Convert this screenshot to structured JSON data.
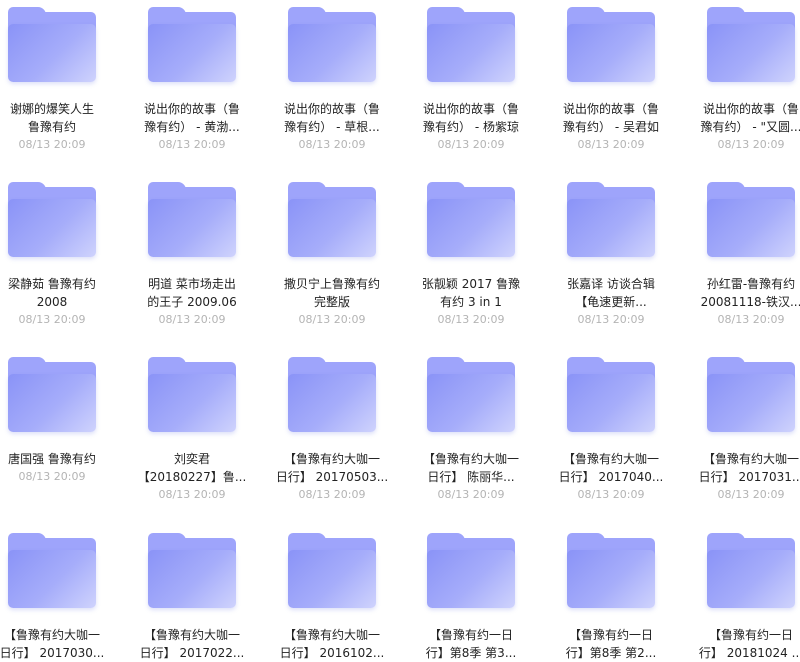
{
  "folders": [
    {
      "line1": "谢娜的爆笑人生",
      "line2": "鲁豫有约",
      "date": "08/13 20:09"
    },
    {
      "line1": "说出你的故事（鲁",
      "line2": "豫有约） - 黄渤...",
      "date": "08/13 20:09"
    },
    {
      "line1": "说出你的故事（鲁",
      "line2": "豫有约） - 草根...",
      "date": "08/13 20:09"
    },
    {
      "line1": "说出你的故事（鲁",
      "line2": "豫有约） - 杨紫琼",
      "date": "08/13 20:09"
    },
    {
      "line1": "说出你的故事（鲁",
      "line2": "豫有约） - 吴君如",
      "date": "08/13 20:09"
    },
    {
      "line1": "说出你的故事（鲁",
      "line2": "豫有约） - \"又圆...",
      "date": "08/13 20:09"
    },
    {
      "line1": "梁静茹 鲁豫有约",
      "line2": "2008",
      "date": "08/13 20:09"
    },
    {
      "line1": "明道 菜市场走出",
      "line2": "的王子 2009.06",
      "date": "08/13 20:09"
    },
    {
      "line1": "撒贝宁上鲁豫有约",
      "line2": "完整版",
      "date": "08/13 20:09"
    },
    {
      "line1": "张靓颖 2017 鲁豫",
      "line2": "有约 3 in 1",
      "date": "08/13 20:09"
    },
    {
      "line1": "张嘉译 访谈合辑",
      "line2": "【龟速更新...",
      "date": "08/13 20:09"
    },
    {
      "line1": "孙红雷-鲁豫有约",
      "line2": "20081118-铁汉...",
      "date": "08/13 20:09"
    },
    {
      "line1": "唐国强 鲁豫有约",
      "line2": "",
      "date": "08/13 20:09"
    },
    {
      "line1": "刘奕君",
      "line2": "【20180227】鲁...",
      "date": "08/13 20:09"
    },
    {
      "line1": "【鲁豫有约大咖一",
      "line2": "日行】 20170503...",
      "date": "08/13 20:09"
    },
    {
      "line1": "【鲁豫有约大咖一",
      "line2": "日行】 陈丽华...",
      "date": "08/13 20:09"
    },
    {
      "line1": "【鲁豫有约大咖一",
      "line2": "日行】 2017040...",
      "date": "08/13 20:09"
    },
    {
      "line1": "【鲁豫有约大咖一",
      "line2": "日行】 2017031...",
      "date": "08/13 20:09"
    },
    {
      "line1": "【鲁豫有约大咖一",
      "line2": "日行】 2017030...",
      "date": ""
    },
    {
      "line1": "【鲁豫有约大咖一",
      "line2": "日行】 2017022...",
      "date": ""
    },
    {
      "line1": "【鲁豫有约大咖一",
      "line2": "日行】 2016102...",
      "date": ""
    },
    {
      "line1": "【鲁豫有约一日",
      "line2": "行】第8季 第3...",
      "date": ""
    },
    {
      "line1": "【鲁豫有约一日",
      "line2": "行】第8季 第2...",
      "date": ""
    },
    {
      "line1": "【鲁豫有约一日",
      "line2": "行】 20181024 ...",
      "date": ""
    }
  ]
}
